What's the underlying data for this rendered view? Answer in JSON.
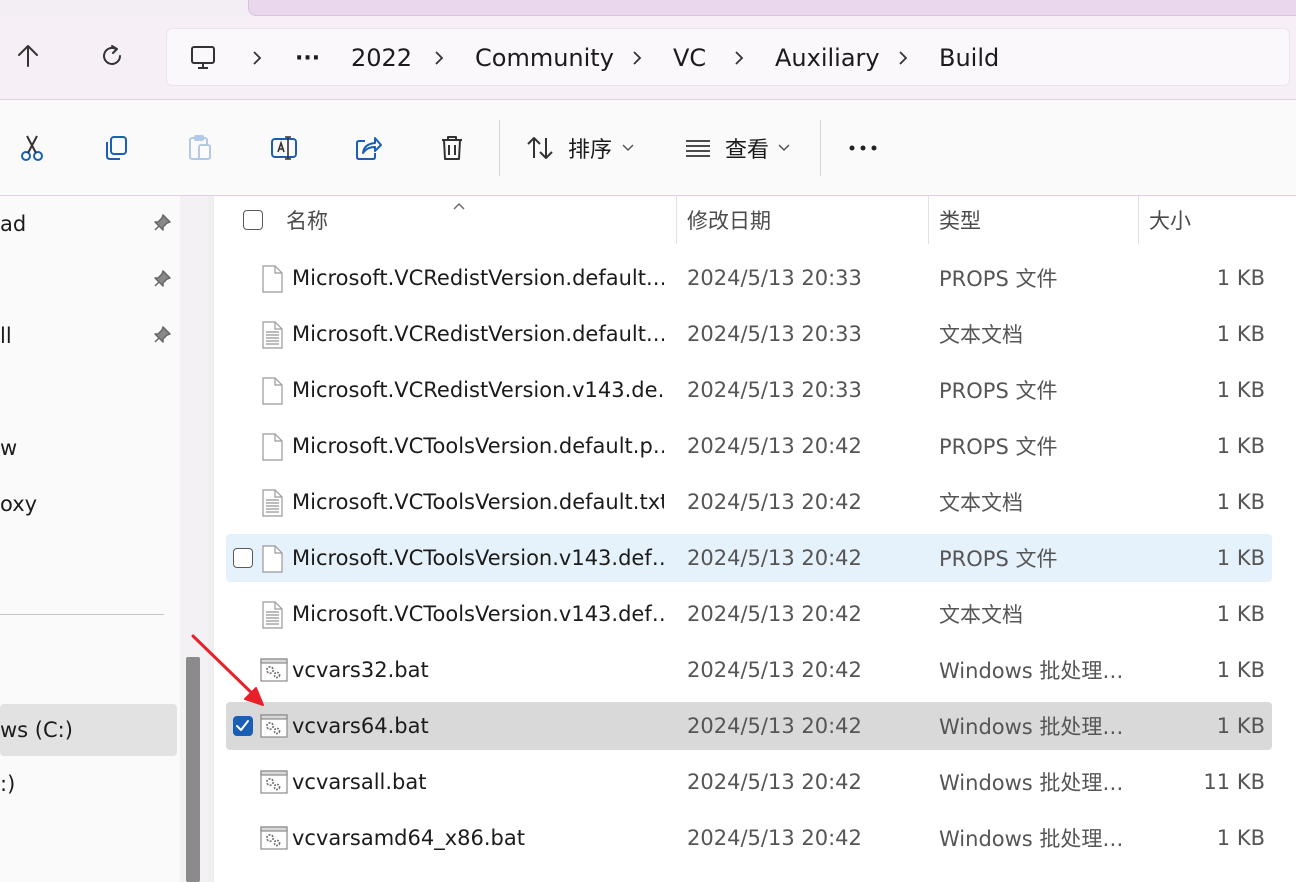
{
  "breadcrumb": {
    "items": [
      "2022",
      "Community",
      "VC",
      "Auxiliary",
      "Build"
    ],
    "overflow": "···"
  },
  "toolbar": {
    "sort_label": "排序",
    "view_label": "查看"
  },
  "nav_pane": {
    "items": [
      {
        "label": "ad",
        "pinned": true
      },
      {
        "label": "",
        "pinned": true
      },
      {
        "label": "ll",
        "pinned": true
      },
      {
        "label": "",
        "pinned": false
      },
      {
        "label": "w",
        "pinned": false
      },
      {
        "label": "oxy",
        "pinned": false
      },
      {
        "label": "ws (C:)",
        "selected": true
      },
      {
        "label": ":)"
      }
    ]
  },
  "columns": {
    "name": "名称",
    "date": "修改日期",
    "type": "类型",
    "size": "大小"
  },
  "files": [
    {
      "name": "Microsoft.VCRedistVersion.default.…",
      "date": "2024/5/13 20:33",
      "type": "PROPS 文件",
      "size": "1 KB",
      "icon": "blank-file-icon"
    },
    {
      "name": "Microsoft.VCRedistVersion.default.…",
      "date": "2024/5/13 20:33",
      "type": "文本文档",
      "size": "1 KB",
      "icon": "text-file-icon"
    },
    {
      "name": "Microsoft.VCRedistVersion.v143.de…",
      "date": "2024/5/13 20:33",
      "type": "PROPS 文件",
      "size": "1 KB",
      "icon": "blank-file-icon"
    },
    {
      "name": "Microsoft.VCToolsVersion.default.p…",
      "date": "2024/5/13 20:42",
      "type": "PROPS 文件",
      "size": "1 KB",
      "icon": "blank-file-icon"
    },
    {
      "name": "Microsoft.VCToolsVersion.default.txt",
      "date": "2024/5/13 20:42",
      "type": "文本文档",
      "size": "1 KB",
      "icon": "text-file-icon"
    },
    {
      "name": "Microsoft.VCToolsVersion.v143.def…",
      "date": "2024/5/13 20:42",
      "type": "PROPS 文件",
      "size": "1 KB",
      "icon": "blank-file-icon",
      "hover": true
    },
    {
      "name": "Microsoft.VCToolsVersion.v143.def…",
      "date": "2024/5/13 20:42",
      "type": "文本文档",
      "size": "1 KB",
      "icon": "text-file-icon"
    },
    {
      "name": "vcvars32.bat",
      "date": "2024/5/13 20:42",
      "type": "Windows 批处理…",
      "size": "1 KB",
      "icon": "batch-file-icon"
    },
    {
      "name": "vcvars64.bat",
      "date": "2024/5/13 20:42",
      "type": "Windows 批处理…",
      "size": "1 KB",
      "icon": "batch-file-icon",
      "selected": true
    },
    {
      "name": "vcvarsall.bat",
      "date": "2024/5/13 20:42",
      "type": "Windows 批处理…",
      "size": "11 KB",
      "icon": "batch-file-icon"
    },
    {
      "name": "vcvarsamd64_x86.bat",
      "date": "2024/5/13 20:42",
      "type": "Windows 批处理…",
      "size": "1 KB",
      "icon": "batch-file-icon"
    }
  ],
  "colors": {
    "accent": "#1a5fb4",
    "selection": "#d9d9d9",
    "hover": "#e5f1fb",
    "annotation_arrow": "#e8202a"
  }
}
